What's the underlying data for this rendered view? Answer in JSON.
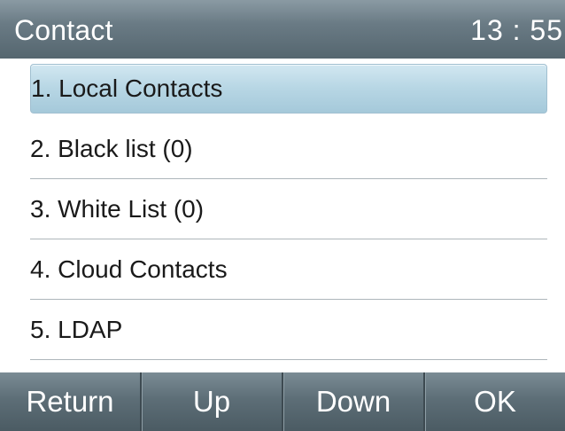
{
  "header": {
    "title": "Contact",
    "time": "13 : 55"
  },
  "menu": {
    "items": [
      {
        "label": "1. Local Contacts",
        "selected": true
      },
      {
        "label": "2. Black list (0)",
        "selected": false
      },
      {
        "label": "3. White List (0)",
        "selected": false
      },
      {
        "label": "4. Cloud Contacts",
        "selected": false
      },
      {
        "label": "5. LDAP",
        "selected": false
      }
    ]
  },
  "softkeys": {
    "return_label": "Return",
    "up_label": "Up",
    "down_label": "Down",
    "ok_label": "OK"
  },
  "colors": {
    "title_bar": "#6a7b85",
    "softkey_bar": "#5d6e77",
    "selection": "#b7d6e4",
    "divider": "#aeb6bb"
  }
}
